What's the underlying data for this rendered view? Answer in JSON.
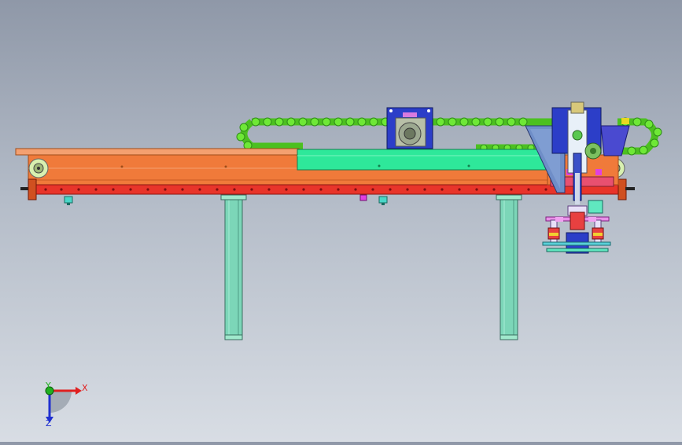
{
  "viewport": {
    "name": "cad-3d-viewport",
    "background_top": "#8f98a8",
    "background_bottom": "#d8dde4"
  },
  "model": {
    "frame_color": "#f07a3a",
    "frame_top_color": "#f4a070",
    "slider_color": "#2ee89a",
    "rail_color": "#e8342a",
    "cable_chain_color": "#6ee836",
    "leg_color": "#7cd6b8",
    "motor_block_color": "#2c3ec8",
    "hopper_color": "#6f8ec8"
  },
  "triad": {
    "x_label": "X",
    "y_label": "Y",
    "z_label": "Z",
    "x_color": "#e02020",
    "y_color": "#20b020",
    "z_color": "#2030d0"
  }
}
